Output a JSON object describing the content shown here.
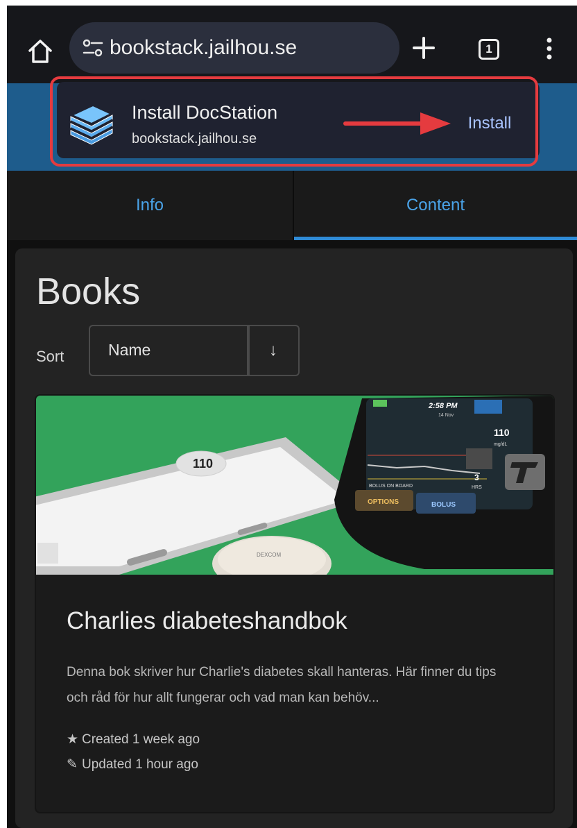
{
  "browser": {
    "url": "bookstack.jailhou.se",
    "tab_count": "1"
  },
  "install_popup": {
    "title": "Install DocStation",
    "domain": "bookstack.jailhou.se",
    "install_label": "Install",
    "highlight_color": "#e53b3f",
    "arrow_color": "#e53b3f"
  },
  "tabs": [
    {
      "label": "Info",
      "active": false
    },
    {
      "label": "Content",
      "active": true
    }
  ],
  "page": {
    "title": "Books",
    "sort_label": "Sort",
    "sort_value": "Name",
    "sort_direction": "↓"
  },
  "book": {
    "title": "Charlies diabeteshandbok",
    "description": "Denna bok skriver hur Charlie's diabetes skall hanteras. Här finner du tips och råd för hur allt fungerar och vad man kan behöv...",
    "created": "Created 1 week ago",
    "updated": "Updated 1 hour ago",
    "cover_texts": {
      "phone_reading": "110",
      "pump_time": "2:58 PM",
      "pump_date": "14 Nov",
      "pump_reading": "110",
      "pump_units": "mg/dL",
      "pump_hours": "3",
      "pump_hrs": "HRS",
      "pump_bolus_on_board": "BOLUS ON BOARD",
      "pump_options": "OPTIONS",
      "pump_bolus": "BOLUS",
      "sensor_brand": "DEXCOM"
    }
  },
  "colors": {
    "accent_blue": "#4aa3e8",
    "header_blue": "#1e5c8c",
    "cover_green": "#33a35b"
  }
}
